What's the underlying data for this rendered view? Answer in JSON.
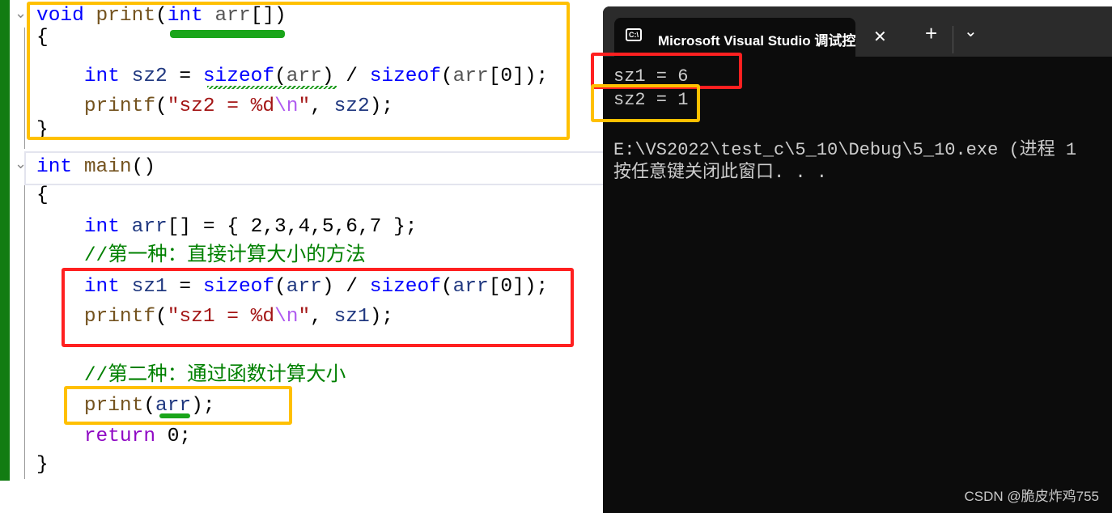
{
  "editor": {
    "lines": [
      [
        {
          "t": "void",
          "c": "#0000ff"
        },
        {
          "t": " "
        },
        {
          "t": "print",
          "c": "#74531f"
        },
        {
          "t": "("
        },
        {
          "t": "int",
          "c": "#0000ff"
        },
        {
          "t": " "
        },
        {
          "t": "arr",
          "c": "#555555"
        },
        {
          "t": "[])"
        }
      ],
      [
        {
          "t": "{"
        }
      ],
      [
        {
          "t": "    "
        },
        {
          "t": "int",
          "c": "#0000ff"
        },
        {
          "t": " "
        },
        {
          "t": "sz2",
          "c": "#1f377f"
        },
        {
          "t": " = "
        },
        {
          "t": "sizeof",
          "c": "#0000ff"
        },
        {
          "t": "("
        },
        {
          "t": "arr",
          "c": "#555555"
        },
        {
          "t": ") / "
        },
        {
          "t": "sizeof",
          "c": "#0000ff"
        },
        {
          "t": "("
        },
        {
          "t": "arr",
          "c": "#555555"
        },
        {
          "t": "[0]);"
        }
      ],
      [
        {
          "t": "    "
        },
        {
          "t": "printf",
          "c": "#74531f"
        },
        {
          "t": "("
        },
        {
          "t": "\"sz2 = %d",
          "c": "#a31515"
        },
        {
          "t": "\\n",
          "c": "#b05cf0"
        },
        {
          "t": "\"",
          "c": "#a31515"
        },
        {
          "t": ", "
        },
        {
          "t": "sz2",
          "c": "#1f377f"
        },
        {
          "t": ");"
        }
      ],
      [
        {
          "t": "}"
        }
      ],
      [
        {
          "t": "int",
          "c": "#0000ff"
        },
        {
          "t": " "
        },
        {
          "t": "main",
          "c": "#74531f"
        },
        {
          "t": "()"
        }
      ],
      [
        {
          "t": "{"
        }
      ],
      [
        {
          "t": "    "
        },
        {
          "t": "int",
          "c": "#0000ff"
        },
        {
          "t": " "
        },
        {
          "t": "arr",
          "c": "#1f377f"
        },
        {
          "t": "[] = { 2,3,4,5,6,7 };"
        }
      ],
      [
        {
          "t": "    "
        },
        {
          "t": "//第一种：直接计算大小的方法",
          "c": "#008000"
        }
      ],
      [
        {
          "t": "    "
        },
        {
          "t": "int",
          "c": "#0000ff"
        },
        {
          "t": " "
        },
        {
          "t": "sz1",
          "c": "#1f377f"
        },
        {
          "t": " = "
        },
        {
          "t": "sizeof",
          "c": "#0000ff"
        },
        {
          "t": "("
        },
        {
          "t": "arr",
          "c": "#1f377f"
        },
        {
          "t": ") / "
        },
        {
          "t": "sizeof",
          "c": "#0000ff"
        },
        {
          "t": "("
        },
        {
          "t": "arr",
          "c": "#1f377f"
        },
        {
          "t": "[0]);"
        }
      ],
      [
        {
          "t": "    "
        },
        {
          "t": "printf",
          "c": "#74531f"
        },
        {
          "t": "("
        },
        {
          "t": "\"sz1 = %d",
          "c": "#a31515"
        },
        {
          "t": "\\n",
          "c": "#b05cf0"
        },
        {
          "t": "\"",
          "c": "#a31515"
        },
        {
          "t": ", "
        },
        {
          "t": "sz1",
          "c": "#1f377f"
        },
        {
          "t": ");"
        }
      ],
      [],
      [
        {
          "t": "    "
        },
        {
          "t": "//第二种：通过函数计算大小",
          "c": "#008000"
        }
      ],
      [
        {
          "t": "    "
        },
        {
          "t": "print",
          "c": "#74531f"
        },
        {
          "t": "("
        },
        {
          "t": "arr",
          "c": "#1f377f"
        },
        {
          "t": ");"
        }
      ],
      [
        {
          "t": "    "
        },
        {
          "t": "return",
          "c": "#8f08c4"
        },
        {
          "t": " 0;"
        }
      ],
      [
        {
          "t": "}"
        }
      ]
    ]
  },
  "terminal": {
    "tab_title": "Microsoft Visual Studio 调试控",
    "tab_icon": "C:\\",
    "close": "✕",
    "new_tab": "+",
    "dropdown": "⌄",
    "lines": [
      "sz1 = 6",
      "sz2 = 1",
      "",
      "E:\\VS2022\\test_c\\5_10\\Debug\\5_10.exe (进程 1",
      "按任意键关闭此窗口. . ."
    ]
  },
  "watermark": "CSDN @脆皮炸鸡755",
  "colors": {
    "annotation_yellow": "#ffc000",
    "annotation_red": "#ff2020",
    "editor_bar": "#127c12",
    "terminal_bg": "#0c0c0c"
  }
}
